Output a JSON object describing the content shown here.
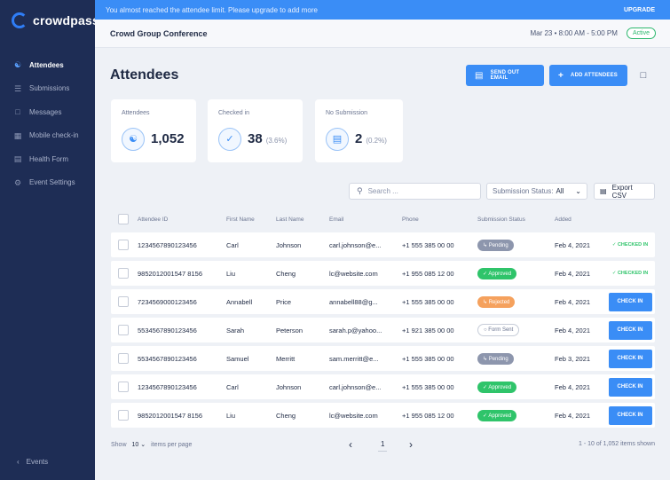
{
  "app": {
    "logo_text": "crowdpass"
  },
  "sidebar": {
    "items": [
      {
        "label": "Attendees",
        "icon": "users-icon",
        "active": true
      },
      {
        "label": "Submissions",
        "icon": "list-icon",
        "active": false
      },
      {
        "label": "Messages",
        "icon": "message-icon",
        "active": false
      },
      {
        "label": "Mobile check-in",
        "icon": "mobile-checkin-icon",
        "active": false
      },
      {
        "label": "Health Form",
        "icon": "form-icon",
        "active": false
      },
      {
        "label": "Event Settings",
        "icon": "gear-icon",
        "active": false
      }
    ],
    "events_label": "Events"
  },
  "banner": {
    "message": "You almost reached the attendee limit. Please upgrade to add more",
    "upgrade_label": "UPGRADE"
  },
  "header": {
    "event_title": "Crowd Group Conference",
    "date": "Mar 23",
    "time": "8:00 AM - 5:00 PM",
    "separator": "•",
    "status": "Active"
  },
  "page": {
    "title": "Attendees",
    "send_email_label": "SEND OUT EMAIL",
    "add_attendees_label": "ADD ATTENDEES"
  },
  "stats": [
    {
      "label": "Attendees",
      "value": "1,052",
      "pct": ""
    },
    {
      "label": "Checked in",
      "value": "38",
      "pct": "(3.6%)"
    },
    {
      "label": "No Submission",
      "value": "2",
      "pct": "(0.2%)"
    }
  ],
  "toolbar": {
    "search_placeholder": "Search ...",
    "status_label": "Submission Status:",
    "status_value": "All",
    "export_label": "Export CSV"
  },
  "table": {
    "headers": [
      "Attendee ID",
      "First Name",
      "Last Name",
      "Email",
      "Phone",
      "Submission Status",
      "Added"
    ],
    "rows": [
      {
        "id": "1234567890123456",
        "first": "Carl",
        "last": "Johnson",
        "email": "carl.johnson@e...",
        "phone": "+1 555 385 00 00",
        "status": "Pending",
        "status_type": "pending",
        "added": "Feb 4, 2021",
        "action": "CHECKED IN",
        "checked": true
      },
      {
        "id": "9852012001547 8156",
        "first": "Liu",
        "last": "Cheng",
        "email": "lc@website.com",
        "phone": "+1 955 085 12 00",
        "status": "Approved",
        "status_type": "approved",
        "added": "Feb 4, 2021",
        "action": "CHECKED IN",
        "checked": true
      },
      {
        "id": "7234569000123456",
        "first": "Annabell",
        "last": "Price",
        "email": "annabell88@g...",
        "phone": "+1 555 385 00 00",
        "status": "Rejected",
        "status_type": "rejected",
        "added": "Feb 4, 2021",
        "action": "CHECK IN",
        "checked": false
      },
      {
        "id": "5534567890123456",
        "first": "Sarah",
        "last": "Peterson",
        "email": "sarah.p@yahoo...",
        "phone": "+1 921 385 00 00",
        "status": "Form Sent",
        "status_type": "formsent",
        "added": "Feb 4, 2021",
        "action": "CHECK IN",
        "checked": false
      },
      {
        "id": "5534567890123456",
        "first": "Samuel",
        "last": "Merritt",
        "email": "sam.merritt@e...",
        "phone": "+1 555 385 00 00",
        "status": "Pending",
        "status_type": "pending",
        "added": "Feb 3, 2021",
        "action": "CHECK IN",
        "checked": false
      },
      {
        "id": "1234567890123456",
        "first": "Carl",
        "last": "Johnson",
        "email": "carl.johnson@e...",
        "phone": "+1 555 385 00 00",
        "status": "Approved",
        "status_type": "approved",
        "added": "Feb 4, 2021",
        "action": "CHECK IN",
        "checked": false
      },
      {
        "id": "9852012001547 8156",
        "first": "Liu",
        "last": "Cheng",
        "email": "lc@website.com",
        "phone": "+1 955 085 12 00",
        "status": "Approved",
        "status_type": "approved",
        "added": "Feb 4, 2021",
        "action": "CHECK IN",
        "checked": false
      }
    ]
  },
  "pagination": {
    "show_label": "Show",
    "per_page": "10",
    "per_page_suffix": "items per page",
    "current_page": "1",
    "summary": "1 - 10 of 1,052 items shown"
  },
  "colors": {
    "primary": "#3a8df6",
    "sidebar": "#1e2d55",
    "success": "#2fc46a",
    "warning": "#f5a15d",
    "neutral": "#8d96ad"
  }
}
